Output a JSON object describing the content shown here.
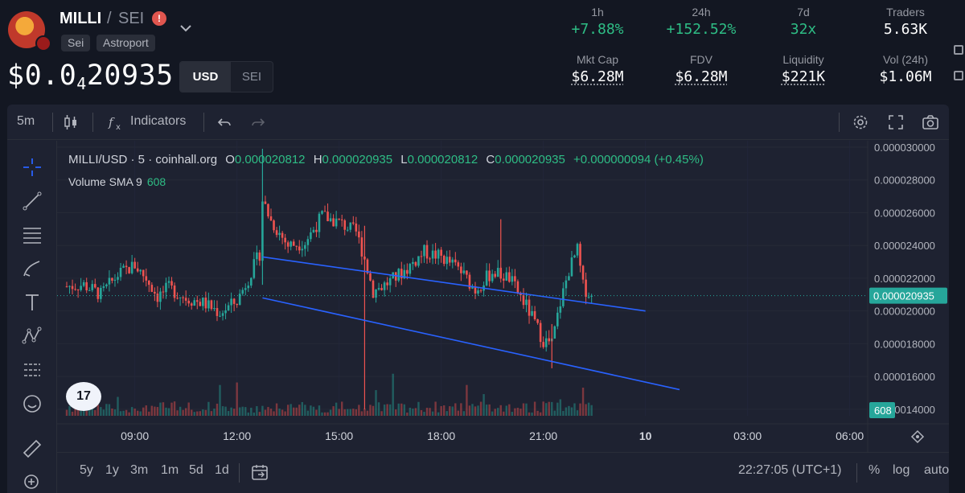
{
  "token": {
    "name": "MILLI",
    "separator": "/",
    "quote": "SEI",
    "warning_glyph": "!",
    "chain": "Sei",
    "dex": "Astroport",
    "price_prefix": "$0.0",
    "price_zero_count": "4",
    "price_digits": "20935"
  },
  "currency_toggle": {
    "options": [
      "USD",
      "SEI"
    ],
    "selected": "USD"
  },
  "stats": [
    {
      "label": "1h",
      "value": "+7.88%",
      "style": "green"
    },
    {
      "label": "24h",
      "value": "+152.52%",
      "style": "green"
    },
    {
      "label": "7d",
      "value": "32x",
      "style": "green"
    },
    {
      "label": "Traders",
      "value": "5.63K",
      "style": "white"
    },
    {
      "label": "Mkt Cap",
      "value": "$6.28M",
      "style": "ul"
    },
    {
      "label": "FDV",
      "value": "$6.28M",
      "style": "ul"
    },
    {
      "label": "Liquidity",
      "value": "$221K",
      "style": "ul"
    },
    {
      "label": "Vol (24h)",
      "value": "$1.06M",
      "style": "white"
    }
  ],
  "toolbar": {
    "interval": "5m",
    "indicators_label": "Indicators"
  },
  "legend": {
    "symbol": "MILLI/USD · 5 · coinhall.org",
    "o_label": "O",
    "o_value": "0.000020812",
    "h_label": "H",
    "h_value": "0.000020935",
    "l_label": "L",
    "l_value": "0.000020812",
    "c_label": "C",
    "c_value": "0.000020935",
    "change": "+0.000000094 (+0.45%)",
    "volume_label": "Volume SMA 9",
    "volume_value": "608"
  },
  "watermark": "17",
  "bottom_bar": {
    "ranges": [
      "5y",
      "1y",
      "3m",
      "1m",
      "5d",
      "1d"
    ],
    "time": "22:27:05 (UTC+1)",
    "percent": "%",
    "log": "log",
    "auto": "auto"
  },
  "colors": {
    "up": "#26a69a",
    "down": "#ef5350",
    "trendline": "#2962ff",
    "price_tag": "#26a69a"
  },
  "chart_data": {
    "type": "candlestick",
    "symbol": "MILLI/USD",
    "interval": "5",
    "x_ticks": [
      "09:00",
      "12:00",
      "15:00",
      "18:00",
      "21:00",
      "10",
      "03:00",
      "06:00"
    ],
    "y_ticks": [
      "0.000030000",
      "0.000028000",
      "0.000026000",
      "0.000024000",
      "0.000022000",
      "0.000020000",
      "0.000018000",
      "0.000016000",
      "0.000014000"
    ],
    "ylim": [
      1.36e-05,
      3e-05
    ],
    "last_price": "0.000020935",
    "last_price_value": 2.0935e-05,
    "volume_last": "608",
    "close_path": [
      [
        "07:00",
        2.15e-05
      ],
      [
        "07:30",
        2.16e-05
      ],
      [
        "08:00",
        2.1e-05
      ],
      [
        "08:30",
        2.22e-05
      ],
      [
        "09:00",
        2.28e-05
      ],
      [
        "09:20",
        2.2e-05
      ],
      [
        "09:40",
        2.09e-05
      ],
      [
        "10:00",
        2.14e-05
      ],
      [
        "10:30",
        2.08e-05
      ],
      [
        "11:00",
        2.05e-05
      ],
      [
        "11:30",
        1.99e-05
      ],
      [
        "12:00",
        2.06e-05
      ],
      [
        "12:20",
        2.2e-05
      ],
      [
        "12:40",
        2.35e-05
      ],
      [
        "12:45",
        2.68e-05
      ],
      [
        "13:00",
        2.55e-05
      ],
      [
        "13:30",
        2.4e-05
      ],
      [
        "14:00",
        2.42e-05
      ],
      [
        "14:30",
        2.58e-05
      ],
      [
        "15:00",
        2.54e-05
      ],
      [
        "15:30",
        2.48e-05
      ],
      [
        "15:45",
        2.32e-05
      ],
      [
        "16:00",
        2.12e-05
      ],
      [
        "16:30",
        2.18e-05
      ],
      [
        "17:00",
        2.26e-05
      ],
      [
        "17:30",
        2.36e-05
      ],
      [
        "18:00",
        2.33e-05
      ],
      [
        "18:30",
        2.26e-05
      ],
      [
        "19:00",
        2.13e-05
      ],
      [
        "19:30",
        2.24e-05
      ],
      [
        "20:00",
        2.2e-05
      ],
      [
        "20:30",
        2.03e-05
      ],
      [
        "21:00",
        1.82e-05
      ],
      [
        "21:15",
        1.8e-05
      ],
      [
        "21:30",
        2.05e-05
      ],
      [
        "21:45",
        2.25e-05
      ],
      [
        "22:00",
        2.37e-05
      ],
      [
        "22:10",
        2.15e-05
      ],
      [
        "22:25",
        2.09e-05
      ]
    ],
    "trend_channel": {
      "upper": [
        [
          "12:45",
          2.33e-05
        ],
        [
          "00:00",
          2e-05
        ]
      ],
      "lower": [
        [
          "12:45",
          2.08e-05
        ],
        [
          "01:00",
          1.52e-05
        ]
      ]
    }
  }
}
